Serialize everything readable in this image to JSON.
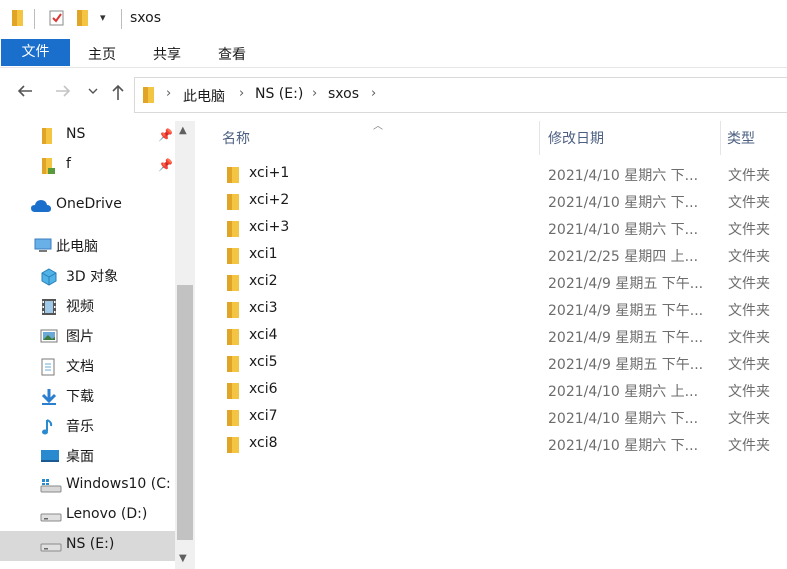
{
  "window": {
    "title": "sxos"
  },
  "ribbon": {
    "file_tab": "文件",
    "tabs": [
      "主页",
      "共享",
      "查看"
    ]
  },
  "address": {
    "crumbs": [
      "此电脑",
      "NS (E:)",
      "sxos"
    ]
  },
  "nav": {
    "items": [
      {
        "label": "NS",
        "icon": "folder-icon",
        "pinned": true
      },
      {
        "label": "f",
        "icon": "folder-download-icon",
        "pinned": true
      },
      {
        "label": "OneDrive",
        "icon": "onedrive-icon"
      },
      {
        "label": "此电脑",
        "icon": "this-pc-icon"
      },
      {
        "label": "3D 对象",
        "icon": "3d-objects-icon"
      },
      {
        "label": "视频",
        "icon": "videos-icon"
      },
      {
        "label": "图片",
        "icon": "pictures-icon"
      },
      {
        "label": "文档",
        "icon": "documents-icon"
      },
      {
        "label": "下载",
        "icon": "downloads-icon"
      },
      {
        "label": "音乐",
        "icon": "music-icon"
      },
      {
        "label": "桌面",
        "icon": "desktop-icon"
      },
      {
        "label": "Windows10 (C:",
        "icon": "system-drive-icon"
      },
      {
        "label": "Lenovo (D:)",
        "icon": "drive-icon"
      },
      {
        "label": "NS (E:)",
        "icon": "drive-icon",
        "selected": true
      }
    ]
  },
  "columns": {
    "name": "名称",
    "date": "修改日期",
    "type": "类型"
  },
  "files": [
    {
      "name": "xci+1",
      "date": "2021/4/10 星期六 下...",
      "type": "文件夹"
    },
    {
      "name": "xci+2",
      "date": "2021/4/10 星期六 下...",
      "type": "文件夹"
    },
    {
      "name": "xci+3",
      "date": "2021/4/10 星期六 下...",
      "type": "文件夹"
    },
    {
      "name": "xci1",
      "date": "2021/2/25 星期四 上...",
      "type": "文件夹"
    },
    {
      "name": "xci2",
      "date": "2021/4/9 星期五 下午...",
      "type": "文件夹"
    },
    {
      "name": "xci3",
      "date": "2021/4/9 星期五 下午...",
      "type": "文件夹"
    },
    {
      "name": "xci4",
      "date": "2021/4/9 星期五 下午...",
      "type": "文件夹"
    },
    {
      "name": "xci5",
      "date": "2021/4/9 星期五 下午...",
      "type": "文件夹"
    },
    {
      "name": "xci6",
      "date": "2021/4/10 星期六 上...",
      "type": "文件夹"
    },
    {
      "name": "xci7",
      "date": "2021/4/10 星期六 下...",
      "type": "文件夹"
    },
    {
      "name": "xci8",
      "date": "2021/4/10 星期六 下...",
      "type": "文件夹"
    }
  ],
  "colors": {
    "accent": "#1a6ecc",
    "folder": "#f4c542",
    "folder_dark": "#e0a526",
    "header_text": "#4d6082"
  }
}
